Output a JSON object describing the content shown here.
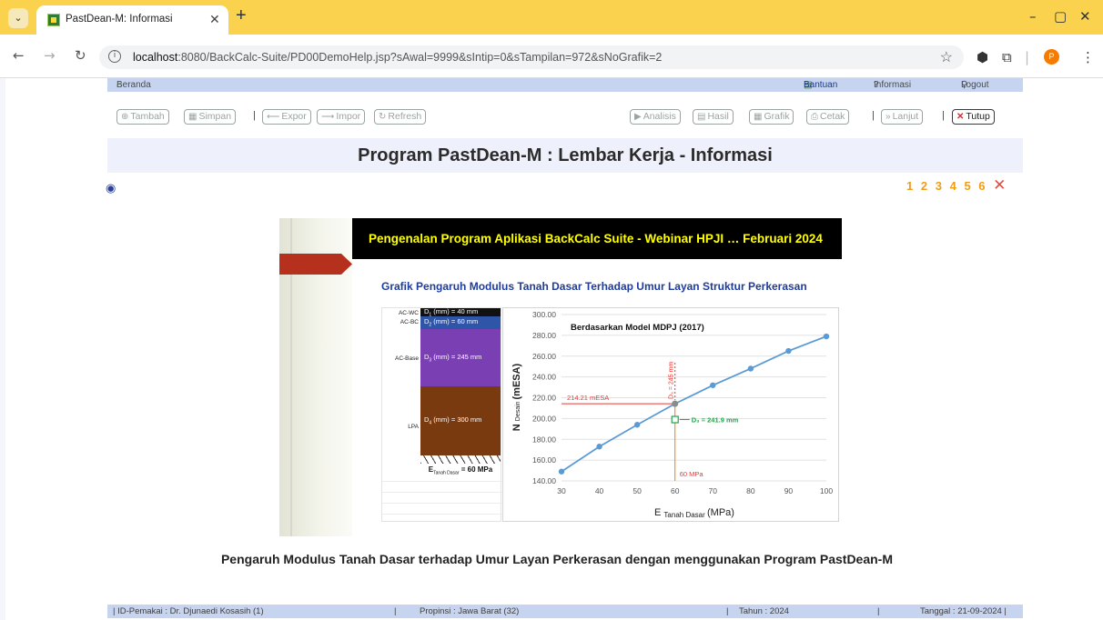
{
  "browser": {
    "tab_title": "PastDean-M: Informasi",
    "url_host": "localhost",
    "url_rest": ":8080/BackCalc-Suite/PD00DemoHelp.jsp?sAwal=9999&sIntip=0&sTampilan=972&sNoGrafik=2",
    "profile_initial": "P"
  },
  "topnav": {
    "home_label": "Beranda",
    "bantuan_label": "Bantuan",
    "informasi_label": "Informasi",
    "logout_label": "Logout"
  },
  "toolbar": {
    "tambah": "Tambah",
    "simpan": "Simpan",
    "expor": "Expor",
    "impor": "Impor",
    "refresh": "Refresh",
    "analisis": "Analisis",
    "hasil": "Hasil",
    "grafik": "Grafik",
    "cetak": "Cetak",
    "lanjut": "Lanjut",
    "tutup": "Tutup"
  },
  "page_title": "Program PastDean-M : Lembar Kerja - Informasi",
  "pager": [
    "1",
    "2",
    "3",
    "4",
    "5",
    "6"
  ],
  "slide": {
    "banner": "Pengenalan Program Aplikasi BackCalc Suite - Webinar HPJI … Februari 2024",
    "subtitle": "Grafik Pengaruh Modulus Tanah Dasar Terhadap Umur Layan Struktur Perkerasan",
    "layers": [
      {
        "name": "AC-WC",
        "thickness": "(mm) = 40 mm",
        "d": "1",
        "color": "#111111"
      },
      {
        "name": "AC-BC",
        "thickness": "(mm) = 60 mm",
        "d": "2",
        "color": "#2f55a8"
      },
      {
        "name": "AC-Base",
        "thickness": "(mm) = 245 mm",
        "d": "3",
        "color": "#7a3fb3"
      },
      {
        "name": "LPA",
        "thickness": "(mm) = 300 mm",
        "d": "4",
        "color": "#7a3a10"
      }
    ],
    "tanah_label_pre": "E",
    "tanah_label_sub": "Tanah Dasar",
    "tanah_label_post": " = 60 MPa"
  },
  "chart_data": {
    "type": "line",
    "title": "Berdasarkan Model MDPJ (2017)",
    "xlabel_main": "E",
    "xlabel_sub": "Tanah Dasar",
    "xlabel_unit": "(MPa)",
    "ylabel_main": "N",
    "ylabel_sub": "Desain",
    "ylabel_unit": "(mESA)",
    "xlim": [
      30,
      100
    ],
    "ylim": [
      140,
      300
    ],
    "xticks": [
      "30",
      "40",
      "50",
      "60",
      "70",
      "80",
      "90",
      "100"
    ],
    "yticks": [
      "140.00",
      "160.00",
      "180.00",
      "200.00",
      "220.00",
      "240.00",
      "260.00",
      "280.00",
      "300.00"
    ],
    "series": [
      {
        "x": [
          30,
          40,
          50,
          60,
          70,
          80,
          90,
          100
        ],
        "values": [
          149,
          173,
          194,
          214.21,
          232,
          248,
          265,
          279
        ]
      }
    ],
    "annotations": {
      "esa_label": "214.21 mESA",
      "mpa_label": "60 MPa",
      "d3_label": "D₃ = 245 mm",
      "d3b_label": "D₃ = 241.9 mm",
      "marker_x": 60,
      "marker_y": 214.21,
      "square_y": 199
    },
    "grid": true
  },
  "caption": "Pengaruh Modulus Tanah Dasar terhadap Umur Layan Perkerasan dengan menggunakan Program PastDean-M",
  "footer": {
    "user": "| ID-Pemakai : Dr. Djunaedi Kosasih (1)",
    "province": "Propinsi : Jawa Barat (32)",
    "year": "Tahun : 2024",
    "date": "Tanggal : 21-09-2024 |"
  }
}
